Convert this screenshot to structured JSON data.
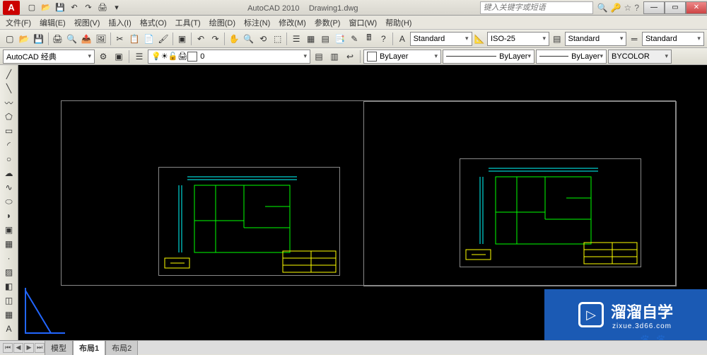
{
  "app": {
    "name": "AutoCAD 2010",
    "doc": "Drawing1.dwg",
    "search_placeholder": "键入关键字或短语"
  },
  "menu": [
    "文件(F)",
    "编辑(E)",
    "视图(V)",
    "插入(I)",
    "格式(O)",
    "工具(T)",
    "绘图(D)",
    "标注(N)",
    "修改(M)",
    "参数(P)",
    "窗口(W)",
    "帮助(H)"
  ],
  "workspace": {
    "label": "AutoCAD 经典"
  },
  "styles": {
    "textstyle_label": "Standard",
    "dimstyle_label": "ISO-25",
    "tablestyle_label": "Standard",
    "mlstyle_label": "Standard"
  },
  "layers": {
    "current": "ByLayer",
    "linetype": "ByLayer",
    "lineweight": "ByLayer",
    "plotstyle": "BYCOLOR"
  },
  "tabs": {
    "model": "模型",
    "layout1": "布局1",
    "layout2": "布局2"
  },
  "watermark": {
    "brand": "溜溜自学",
    "url": "zixue.3d66.com"
  },
  "colors": {
    "accent": "#c00",
    "canvas": "#000",
    "green": "#0f0",
    "cyan": "#0ff",
    "yellow": "#ff0"
  }
}
